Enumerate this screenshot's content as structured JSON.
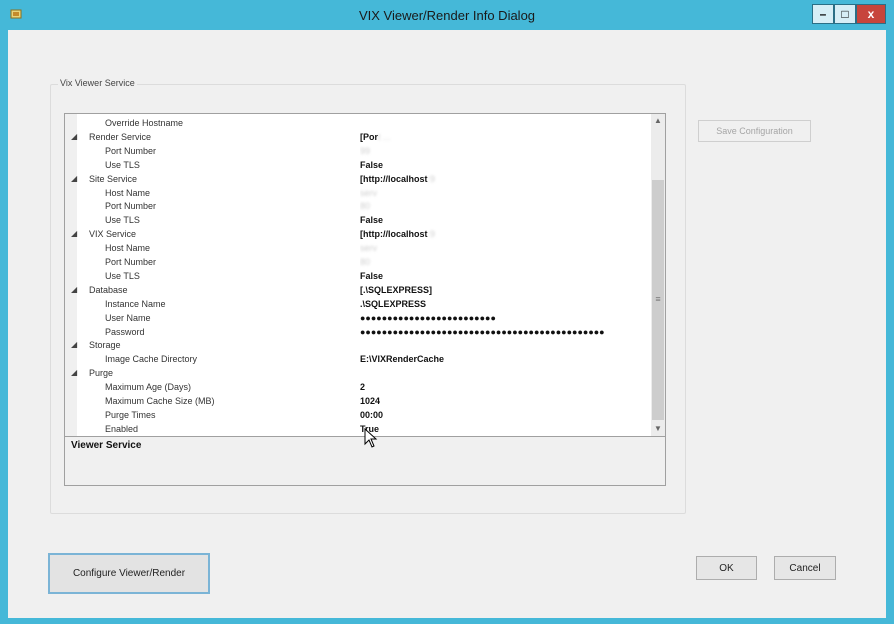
{
  "window": {
    "title": "VIX Viewer/Render Info Dialog",
    "controls": {
      "minimize": "–",
      "maximize": "□",
      "close": "x"
    }
  },
  "group": {
    "label": "Vix Viewer Service"
  },
  "grid": {
    "rows": [
      {
        "name": "Override Hostname",
        "value": "",
        "expander": false
      },
      {
        "name": "Render Service",
        "value": "[Por",
        "blur": "t ...",
        "expander": true
      },
      {
        "name": "Port Number",
        "value": "",
        "blur": "99",
        "expander": false
      },
      {
        "name": "Use TLS",
        "value": "False",
        "expander": false
      },
      {
        "name": "Site Service",
        "value": "[http://localhost",
        "blur": ":9",
        "expander": true
      },
      {
        "name": "Host Name",
        "value": "",
        "blur": "serv",
        "expander": false
      },
      {
        "name": "Port Number",
        "value": "",
        "blur": "80",
        "expander": false
      },
      {
        "name": "Use TLS",
        "value": "False",
        "expander": false
      },
      {
        "name": "VIX Service",
        "value": "[http://localhost",
        "blur": ":9",
        "expander": true
      },
      {
        "name": "Host Name",
        "value": "",
        "blur": "serv",
        "expander": false
      },
      {
        "name": "Port Number",
        "value": "",
        "blur": "80",
        "expander": false
      },
      {
        "name": "Use TLS",
        "value": "False",
        "expander": false
      },
      {
        "name": "Database",
        "value": "[.\\SQLEXPRESS]",
        "expander": true
      },
      {
        "name": "Instance Name",
        "value": ".\\SQLEXPRESS",
        "expander": false
      },
      {
        "name": "User Name",
        "value": "●●●●●●●●●●●●●●●●●●●●●●●●●",
        "expander": false
      },
      {
        "name": "Password",
        "value": "●●●●●●●●●●●●●●●●●●●●●●●●●●●●●●●●●●●●●●●●●●●●●",
        "expander": false
      },
      {
        "name": "Storage",
        "value": "",
        "expander": true
      },
      {
        "name": "Image Cache Directory",
        "value": "E:\\VIXRenderCache",
        "expander": false
      },
      {
        "name": "Purge",
        "value": "",
        "expander": true
      },
      {
        "name": "Maximum Age (Days)",
        "value": "2",
        "expander": false
      },
      {
        "name": "Maximum Cache Size (MB)",
        "value": "1024",
        "expander": false
      },
      {
        "name": "Purge Times",
        "value": "00:00",
        "expander": false
      },
      {
        "name": "Enabled",
        "value": "True",
        "expander": false
      }
    ]
  },
  "description": {
    "title": "Viewer Service"
  },
  "buttons": {
    "save_configuration": "Save Configuration",
    "configure_viewer_render": "Configure Viewer/Render",
    "ok": "OK",
    "cancel": "Cancel"
  },
  "icons": {
    "expander": "expander-triangle-icon",
    "scroll_up": "scroll-up-icon",
    "scroll_down": "scroll-down-icon"
  }
}
